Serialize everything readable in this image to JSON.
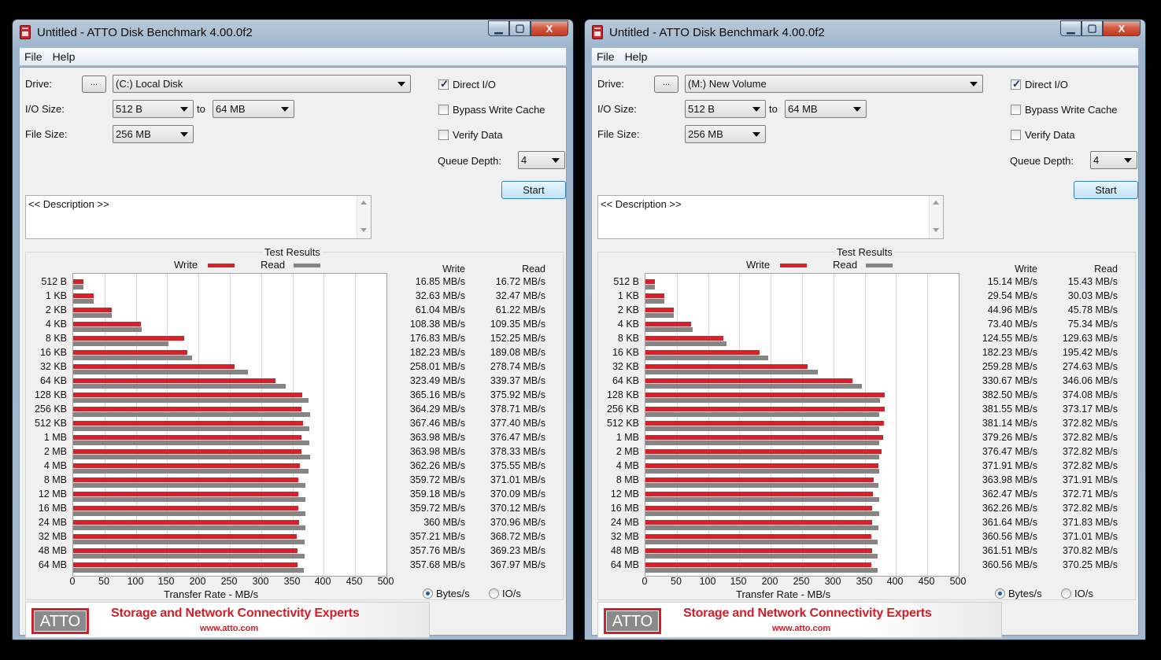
{
  "windows": [
    {
      "title": "Untitled - ATTO Disk Benchmark 4.00.0f2",
      "caption_buttons": {
        "minimize": "▁",
        "maximize": "▢",
        "close": "X"
      },
      "menu": [
        "File",
        "Help"
      ],
      "drive_label": "Drive:",
      "browse_label": "...",
      "drive_value": "(C:) Local Disk",
      "io_size_label": "I/O Size:",
      "io_from": "512 B",
      "to_label": "to",
      "io_to": "64 MB",
      "file_size_label": "File Size:",
      "file_size": "256 MB",
      "direct_io": "Direct I/O",
      "bypass_cache": "Bypass Write Cache",
      "verify_data": "Verify Data",
      "queue_depth_label": "Queue Depth:",
      "queue_depth": "4",
      "start_label": "Start",
      "description": "<< Description >>",
      "results_title": "Test Results",
      "legend_write": "Write",
      "legend_read": "Read",
      "col_write": "Write",
      "col_read": "Read",
      "xlabel": "Transfer Rate - MB/s",
      "radio_bytes": "Bytes/s",
      "radio_io": "IO/s",
      "banner_logo": "ATTO",
      "banner_tagline": "Storage and Network Connectivity Experts",
      "banner_url": "www.atto.com",
      "chart_data": {
        "type": "bar",
        "orientation": "horizontal",
        "categories": [
          "512 B",
          "1 KB",
          "2 KB",
          "4 KB",
          "8 KB",
          "16 KB",
          "32 KB",
          "64 KB",
          "128 KB",
          "256 KB",
          "512 KB",
          "1 MB",
          "2 MB",
          "4 MB",
          "8 MB",
          "12 MB",
          "16 MB",
          "24 MB",
          "32 MB",
          "48 MB",
          "64 MB"
        ],
        "series": [
          {
            "name": "Write",
            "color": "#d8202a",
            "values": [
              16.85,
              32.63,
              61.04,
              108.38,
              176.83,
              182.23,
              258.01,
              323.49,
              365.16,
              364.29,
              367.46,
              363.98,
              363.98,
              362.26,
              359.72,
              359.18,
              359.72,
              360,
              357.21,
              357.76,
              357.68
            ]
          },
          {
            "name": "Read",
            "color": "#858585",
            "values": [
              16.72,
              32.47,
              61.22,
              109.35,
              152.25,
              189.08,
              278.74,
              339.37,
              375.92,
              378.71,
              377.4,
              376.47,
              378.33,
              375.55,
              371.01,
              370.09,
              370.12,
              370.96,
              368.72,
              369.23,
              367.97
            ]
          }
        ],
        "write_text": [
          "16.85 MB/s",
          "32.63 MB/s",
          "61.04 MB/s",
          "108.38 MB/s",
          "176.83 MB/s",
          "182.23 MB/s",
          "258.01 MB/s",
          "323.49 MB/s",
          "365.16 MB/s",
          "364.29 MB/s",
          "367.46 MB/s",
          "363.98 MB/s",
          "363.98 MB/s",
          "362.26 MB/s",
          "359.72 MB/s",
          "359.18 MB/s",
          "359.72 MB/s",
          "360 MB/s",
          "357.21 MB/s",
          "357.76 MB/s",
          "357.68 MB/s"
        ],
        "read_text": [
          "16.72 MB/s",
          "32.47 MB/s",
          "61.22 MB/s",
          "109.35 MB/s",
          "152.25 MB/s",
          "189.08 MB/s",
          "278.74 MB/s",
          "339.37 MB/s",
          "375.92 MB/s",
          "378.71 MB/s",
          "377.40 MB/s",
          "376.47 MB/s",
          "378.33 MB/s",
          "375.55 MB/s",
          "371.01 MB/s",
          "370.09 MB/s",
          "370.12 MB/s",
          "370.96 MB/s",
          "368.72 MB/s",
          "369.23 MB/s",
          "367.97 MB/s"
        ],
        "xlim": [
          0,
          500
        ],
        "xticks": [
          "0",
          "50",
          "100",
          "150",
          "200",
          "250",
          "300",
          "350",
          "400",
          "450",
          "500"
        ]
      }
    },
    {
      "title": "Untitled - ATTO Disk Benchmark 4.00.0f2",
      "caption_buttons": {
        "minimize": "▁",
        "maximize": "▢",
        "close": "X"
      },
      "menu": [
        "File",
        "Help"
      ],
      "drive_label": "Drive:",
      "browse_label": "...",
      "drive_value": "(M:) New Volume",
      "io_size_label": "I/O Size:",
      "io_from": "512 B",
      "to_label": "to",
      "io_to": "64 MB",
      "file_size_label": "File Size:",
      "file_size": "256 MB",
      "direct_io": "Direct I/O",
      "bypass_cache": "Bypass Write Cache",
      "verify_data": "Verify Data",
      "queue_depth_label": "Queue Depth:",
      "queue_depth": "4",
      "start_label": "Start",
      "description": "<< Description >>",
      "results_title": "Test Results",
      "legend_write": "Write",
      "legend_read": "Read",
      "col_write": "Write",
      "col_read": "Read",
      "xlabel": "Transfer Rate - MB/s",
      "radio_bytes": "Bytes/s",
      "radio_io": "IO/s",
      "banner_logo": "ATTO",
      "banner_tagline": "Storage and Network Connectivity Experts",
      "banner_url": "www.atto.com",
      "chart_data": {
        "type": "bar",
        "orientation": "horizontal",
        "categories": [
          "512 B",
          "1 KB",
          "2 KB",
          "4 KB",
          "8 KB",
          "16 KB",
          "32 KB",
          "64 KB",
          "128 KB",
          "256 KB",
          "512 KB",
          "1 MB",
          "2 MB",
          "4 MB",
          "8 MB",
          "12 MB",
          "16 MB",
          "24 MB",
          "32 MB",
          "48 MB",
          "64 MB"
        ],
        "series": [
          {
            "name": "Write",
            "color": "#d8202a",
            "values": [
              15.14,
              29.54,
              44.96,
              73.4,
              124.55,
              182.23,
              259.28,
              330.67,
              382.5,
              381.55,
              381.14,
              379.26,
              376.47,
              371.91,
              363.98,
              362.47,
              362.26,
              361.64,
              360.56,
              361.51,
              360.56
            ]
          },
          {
            "name": "Read",
            "color": "#858585",
            "values": [
              15.43,
              30.03,
              45.78,
              75.34,
              129.63,
              195.42,
              274.63,
              346.06,
              374.08,
              373.17,
              372.82,
              372.82,
              372.82,
              372.82,
              371.91,
              372.71,
              372.82,
              371.83,
              371.01,
              370.82,
              370.25
            ]
          }
        ],
        "write_text": [
          "15.14 MB/s",
          "29.54 MB/s",
          "44.96 MB/s",
          "73.40 MB/s",
          "124.55 MB/s",
          "182.23 MB/s",
          "259.28 MB/s",
          "330.67 MB/s",
          "382.50 MB/s",
          "381.55 MB/s",
          "381.14 MB/s",
          "379.26 MB/s",
          "376.47 MB/s",
          "371.91 MB/s",
          "363.98 MB/s",
          "362.47 MB/s",
          "362.26 MB/s",
          "361.64 MB/s",
          "360.56 MB/s",
          "361.51 MB/s",
          "360.56 MB/s"
        ],
        "read_text": [
          "15.43 MB/s",
          "30.03 MB/s",
          "45.78 MB/s",
          "75.34 MB/s",
          "129.63 MB/s",
          "195.42 MB/s",
          "274.63 MB/s",
          "346.06 MB/s",
          "374.08 MB/s",
          "373.17 MB/s",
          "372.82 MB/s",
          "372.82 MB/s",
          "372.82 MB/s",
          "372.82 MB/s",
          "371.91 MB/s",
          "372.71 MB/s",
          "372.82 MB/s",
          "371.83 MB/s",
          "371.01 MB/s",
          "370.82 MB/s",
          "370.25 MB/s"
        ],
        "xlim": [
          0,
          500
        ],
        "xticks": [
          "0",
          "50",
          "100",
          "150",
          "200",
          "250",
          "300",
          "350",
          "400",
          "450",
          "500"
        ]
      }
    }
  ]
}
